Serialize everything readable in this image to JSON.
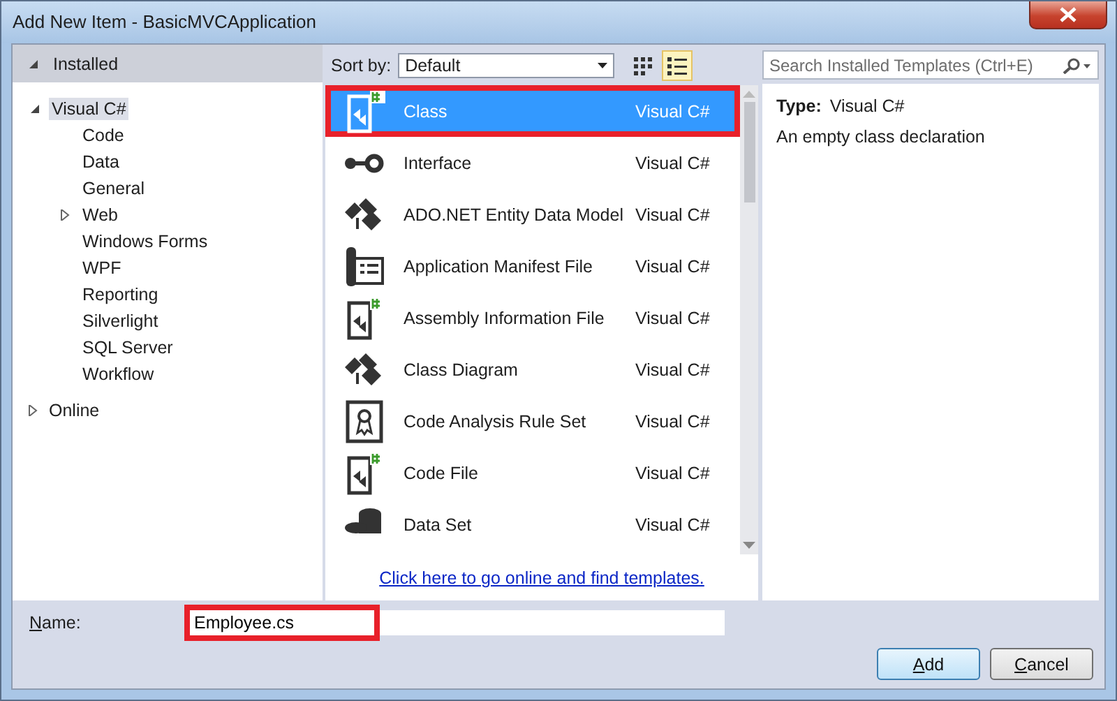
{
  "window": {
    "title": "Add New Item - BasicMVCApplication"
  },
  "sidebar": {
    "header": {
      "label": "Installed",
      "expanded": true
    },
    "tree": [
      {
        "label": "Visual C#",
        "expanded": true,
        "selected": true,
        "children": [
          {
            "label": "Code",
            "selected": false
          },
          {
            "label": "Data",
            "selected": false
          },
          {
            "label": "General",
            "selected": false
          },
          {
            "label": "Web",
            "selected": false,
            "expanded": false,
            "has_children": true
          },
          {
            "label": "Windows Forms",
            "selected": false
          },
          {
            "label": "WPF",
            "selected": false
          },
          {
            "label": "Reporting",
            "selected": false
          },
          {
            "label": "Silverlight",
            "selected": false
          },
          {
            "label": "SQL Server",
            "selected": false
          },
          {
            "label": "Workflow",
            "selected": false
          }
        ]
      }
    ],
    "online": {
      "label": "Online",
      "expanded": false
    }
  },
  "toolbar": {
    "sort_label": "Sort by:",
    "sort_value": "Default",
    "views": [
      {
        "kind": "grid",
        "selected": false
      },
      {
        "kind": "list",
        "selected": true
      }
    ]
  },
  "templates": [
    {
      "name": "Class",
      "language": "Visual C#",
      "selected": true,
      "highlighted": true
    },
    {
      "name": "Interface",
      "language": "Visual C#",
      "selected": false,
      "highlighted": false
    },
    {
      "name": "ADO.NET Entity Data Model",
      "language": "Visual C#",
      "selected": false,
      "highlighted": false
    },
    {
      "name": "Application Manifest File",
      "language": "Visual C#",
      "selected": false,
      "highlighted": false
    },
    {
      "name": "Assembly Information File",
      "language": "Visual C#",
      "selected": false,
      "highlighted": false
    },
    {
      "name": "Class Diagram",
      "language": "Visual C#",
      "selected": false,
      "highlighted": false
    },
    {
      "name": "Code Analysis Rule Set",
      "language": "Visual C#",
      "selected": false,
      "highlighted": false
    },
    {
      "name": "Code File",
      "language": "Visual C#",
      "selected": false,
      "highlighted": false
    },
    {
      "name": "Data Set",
      "language": "Visual C#",
      "selected": false,
      "highlighted": false
    }
  ],
  "online_link": "Click here to go online and find templates.",
  "search": {
    "placeholder": "Search Installed Templates (Ctrl+E)"
  },
  "details": {
    "type_label": "Type:",
    "type_value": "Visual C#",
    "description": "An empty class declaration"
  },
  "name_field": {
    "label": "Name:",
    "value": "Employee.cs",
    "highlighted": true
  },
  "buttons": [
    {
      "label": "Add",
      "default": true
    },
    {
      "label": "Cancel",
      "default": false
    }
  ]
}
